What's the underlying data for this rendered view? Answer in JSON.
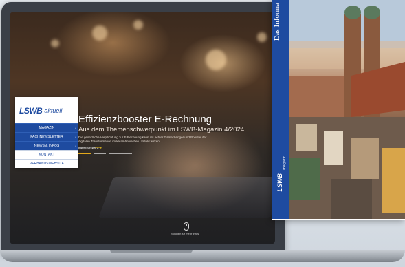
{
  "nav": {
    "logo_brand": "LSWB",
    "logo_suffix": "aktuell",
    "items": [
      {
        "label": "MAGAZIN"
      },
      {
        "label": "FACHNEWSLETTER"
      },
      {
        "label": "NEWS & INFOS"
      },
      {
        "label": "KONTAKT"
      },
      {
        "label": "VERBANDSWEBSITE"
      }
    ]
  },
  "hero": {
    "title": "Effizienzbooster E-Rechnung",
    "subtitle": "Aus dem Themenschwerpunkt im LSWB-Magazin 4/2024",
    "description": "Die gesetzliche Verpflichtung zur E-Rechnung kann als echter Gamechanger und Booster der digitalen Transformation im kaufmännischen Umfeld wirken.",
    "read_more": "weiterlesen »"
  },
  "scroll_hint": "Scrollen für mehr Infos",
  "magazine": {
    "spine_text": "Das Informa",
    "logo": "LSWB",
    "label": "magazin"
  },
  "colors": {
    "brand_blue": "#1e4ba0",
    "accent_yellow": "#e3a81b"
  },
  "icons": [
    "chevron-right-icon",
    "arrow-right-icon",
    "mouse-scroll-icon"
  ]
}
